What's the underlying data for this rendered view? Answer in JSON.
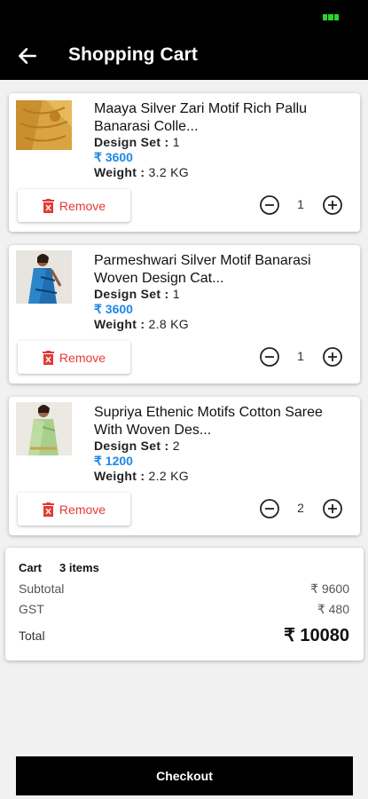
{
  "header": {
    "title": "Shopping Cart"
  },
  "labels": {
    "design_set": "Design Set : ",
    "weight": "Weight : ",
    "remove": "Remove"
  },
  "items": [
    {
      "name": "Maaya  Silver Zari Motif Rich Pallu Banarasi Colle...",
      "design_set": "1",
      "price": "₹ 3600",
      "weight": "3.2 KG",
      "quantity": "1"
    },
    {
      "name": "Parmeshwari Silver Motif Banarasi Woven Design Cat...",
      "design_set": "1",
      "price": "₹ 3600",
      "weight": "2.8 KG",
      "quantity": "1"
    },
    {
      "name": "Supriya Ethenic Motifs Cotton Saree With Woven Des...",
      "design_set": "2",
      "price": "₹ 1200",
      "weight": "2.2 KG",
      "quantity": "2"
    }
  ],
  "summary": {
    "cart_label": "Cart",
    "cart_count": "3 items",
    "subtotal_label": "Subtotal",
    "subtotal_value": "₹ 9600",
    "gst_label": "GST",
    "gst_value": "₹ 480",
    "total_label": "Total",
    "total_value": "₹ 10080"
  },
  "checkout_label": "Checkout",
  "colors": {
    "price": "#1e88e5",
    "remove": "#e53935",
    "battery": "#2bd42b"
  }
}
